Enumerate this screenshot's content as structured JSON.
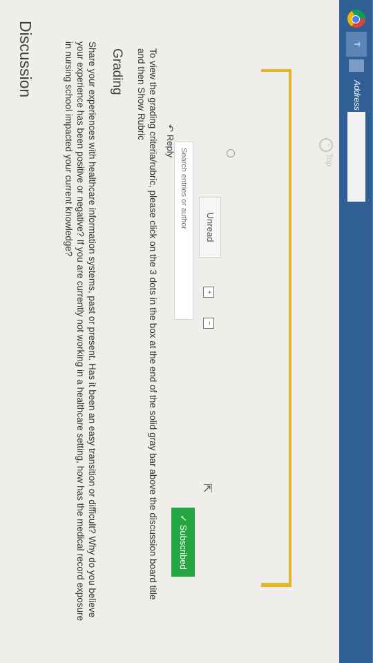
{
  "taskbar": {
    "app_icon": "chrome-icon",
    "tab_label": "T",
    "address_label": "Address"
  },
  "nav": {
    "top_link": "Top",
    "reply_label": "Reply"
  },
  "discussion": {
    "title": "Discussion",
    "description": "Share your experiences with healthcare information systems, past or present. Has it been an easy transition or difficult? Why do you believe your experience has been positive or negative? If you are currently not working in a healthcare setting, how has the medical record exposure in nursing school impacted your current knowledge?",
    "grading_title": "Grading",
    "grading_text": "To view the grading criteria/rubric, please click on the 3 dots in the box at the end of the solid gray bar above the discussion board title and then Show Rubric"
  },
  "toolbar": {
    "search_placeholder": "Search entries or author",
    "unread_label": "Unread",
    "expand_icon": "expand-icon",
    "collapse_icon": "collapse-icon",
    "subscribed_label": "✓ Subscribed",
    "subscribed_color": "#24a742"
  }
}
